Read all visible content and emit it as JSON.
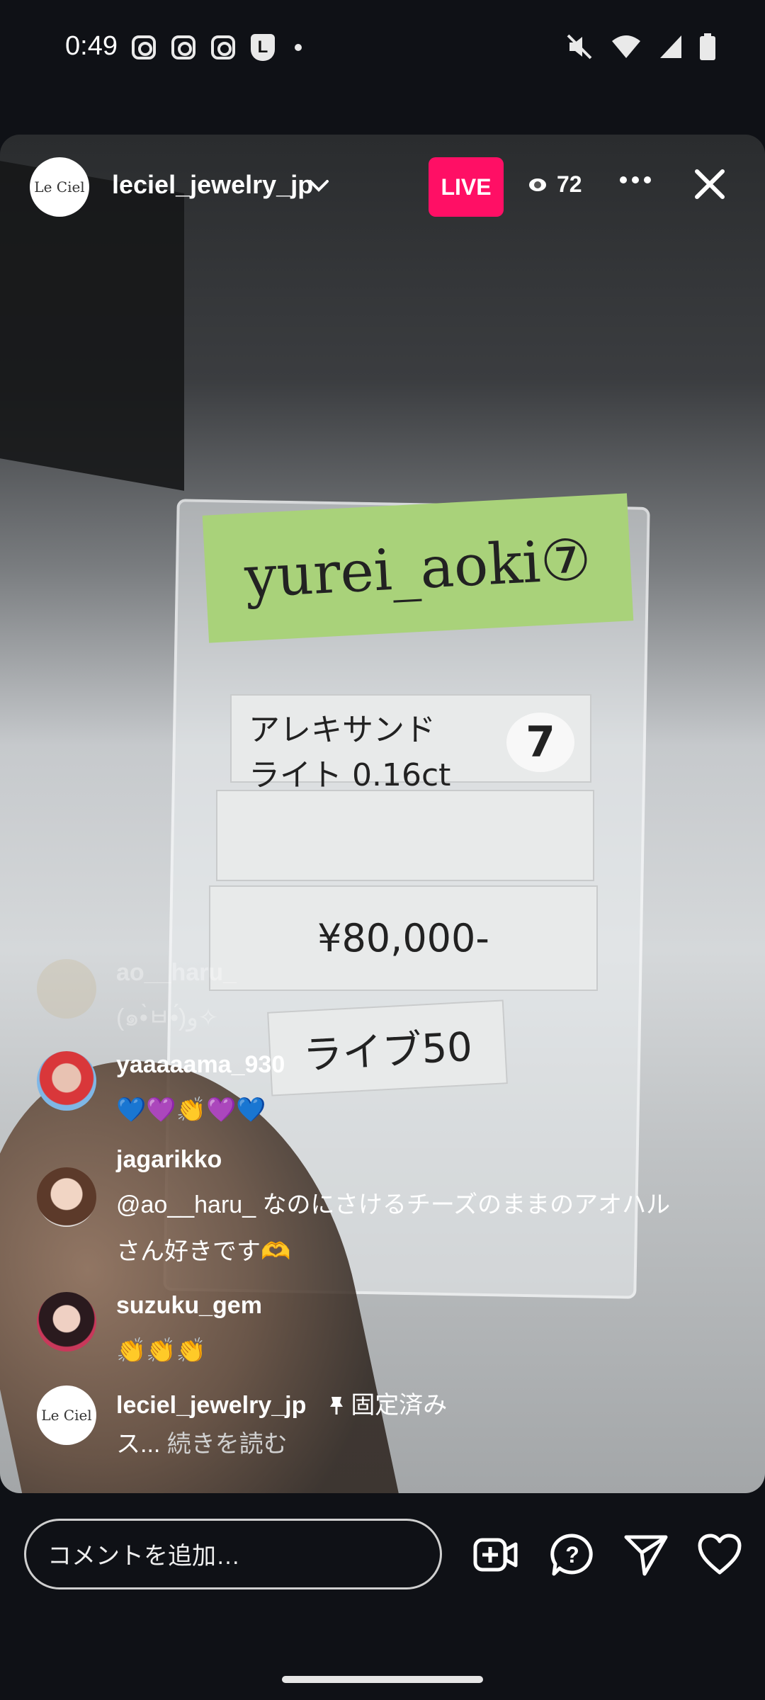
{
  "status_bar": {
    "time": "0:49"
  },
  "header": {
    "avatar_text": "Le Ciel",
    "username": "leciel_jewelry_jp",
    "live_label": "LIVE",
    "viewer_count": "72"
  },
  "video": {
    "sticky_note": "yurei_aoki⑦",
    "label1_text": "アレキサンド\nライト 0.16ct",
    "label1_number": "7",
    "label3_text": "¥80,000-",
    "label4_text": "ライブ50"
  },
  "comments": [
    {
      "user": "ao__haru_",
      "text": "(๑•̀ㅂ•́)و✧"
    },
    {
      "user": "yaaaaama_930",
      "text": "💙💜👏💜💙"
    },
    {
      "user": "jagarikko",
      "text": "@ao__haru_ なのにさけるチーズのままのアオハルさん好きです🫶"
    },
    {
      "user": "suzuku_gem",
      "text": "👏👏👏"
    },
    {
      "user": "leciel_jewelry_jp",
      "pinned": "固定済み",
      "text": "ス...",
      "read_more": "続きを読む"
    }
  ],
  "bottom_bar": {
    "comment_placeholder": "コメントを追加…"
  },
  "colors": {
    "live_badge": "#ff0f65",
    "background": "#0f1116"
  }
}
